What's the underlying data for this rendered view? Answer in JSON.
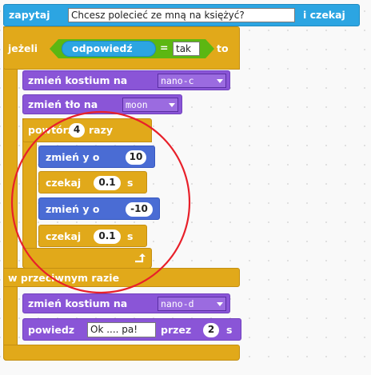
{
  "blocks": {
    "ask": {
      "label": "zapytaj",
      "question": "Chcesz polecieć ze mną na księżyć?",
      "suffix": "i czekaj"
    },
    "if_else": {
      "if_label": "jeżeli",
      "then_label": "to",
      "else_label": "w przeciwnym razie"
    },
    "condition": {
      "reporter": "odpowiedź",
      "operator": "=",
      "value": "tak"
    },
    "costume1": {
      "label": "zmień kostium na",
      "value": "nano-c"
    },
    "backdrop": {
      "label": "zmień tło na",
      "value": "moon"
    },
    "repeat": {
      "label": "powtórz",
      "count": "4",
      "suffix": "razy"
    },
    "change_y1": {
      "label": "zmień y o",
      "value": "10"
    },
    "wait1": {
      "label": "czekaj",
      "value": "0.1",
      "suffix": "s"
    },
    "change_y2": {
      "label": "zmień y o",
      "value": "-10"
    },
    "wait2": {
      "label": "czekaj",
      "value": "0.1",
      "suffix": "s"
    },
    "costume2": {
      "label": "zmień kostium na",
      "value": "nano-d"
    },
    "say": {
      "label": "powiedz",
      "message": "Ok .... pa!",
      "for_label": "przez",
      "seconds": "2",
      "suffix": "s"
    }
  },
  "colors": {
    "sensing": "#2ca5e2",
    "control": "#e1a91a",
    "looks": "#8a55d7",
    "motion": "#4a6cd4",
    "operators": "#5cb712",
    "annotation_circle": "#e8202a"
  }
}
